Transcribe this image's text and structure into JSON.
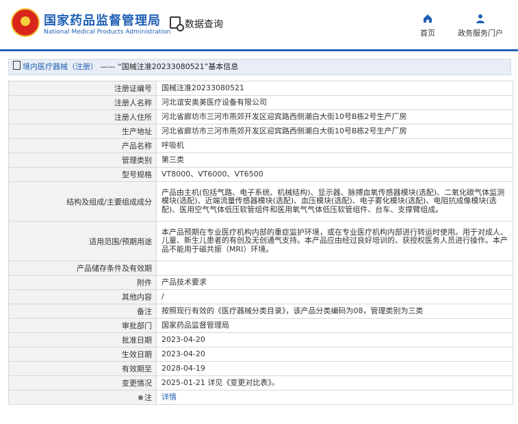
{
  "header": {
    "brand_cn": "国家药品监督管理局",
    "brand_en": "National Medical Products Administration",
    "data_query": "数据查询",
    "nav": [
      {
        "label": "首页",
        "icon": "home-icon"
      },
      {
        "label": "政务服务门户",
        "icon": "user-icon"
      }
    ]
  },
  "breadcrumb": {
    "category": "境内医疗器械（注册）",
    "separator": " —— ",
    "record": "“国械注准20233080521”基本信息"
  },
  "table": [
    {
      "key": "注册证编号",
      "value": "国械注准20233080521"
    },
    {
      "key": "注册人名称",
      "value": "河北谊安奥美医疗设备有限公司"
    },
    {
      "key": "注册人住所",
      "value": "河北省廊坊市三河市燕郊开发区迎宾路西侧潮白大街10号B栋2号生产厂房"
    },
    {
      "key": "生产地址",
      "value": "河北省廊坊市三河市燕郊开发区迎宾路西侧潮白大街10号B栋2号生产厂房"
    },
    {
      "key": "产品名称",
      "value": "呼吸机"
    },
    {
      "key": "管理类别",
      "value": "第三类"
    },
    {
      "key": "型号规格",
      "value": "VT8000、VT6000、VT6500"
    },
    {
      "key": "结构及组成/主要组成成分",
      "value": "产品由主机(包括气路、电子系统、机械结构)、显示器、脉搏血氧传感器模块(选配)、二氧化碳气体监测模块(选配)、近端流量传感器模块(选配)、血压模块(选配)、电子雾化模块(选配)、电阻抗成像模块(选配)、医用空气气体低压软管组件和医用氧气气体低压软管组件、台车、支撑臂组成。"
    },
    {
      "key": "适用范围/预期用途",
      "value": "本产品预期在专业医疗机构内部的重症监护环境，或在专业医疗机构内部进行转运时使用。用于对成人、儿童、新生儿患者的有创及无创通气支持。本产品应由经过良好培训的、获授权医务人员进行操作。本产品不能用于磁共振（MRI）环境。"
    },
    {
      "key": "产品储存条件及有效期",
      "value": ""
    },
    {
      "key": "附件",
      "value": "产品技术要求"
    },
    {
      "key": "其他内容",
      "value": "/"
    },
    {
      "key": "备注",
      "value": "按照现行有效的《医疗器械分类目录》，该产品分类编码为08，管理类别为三类"
    },
    {
      "key": "审批部门",
      "value": "国家药品监督管理局"
    },
    {
      "key": "批准日期",
      "value": "2023-04-20"
    },
    {
      "key": "生效日期",
      "value": "2023-04-20"
    },
    {
      "key": "有效期至",
      "value": "2028-04-19"
    },
    {
      "key": "变更情况",
      "value": "2025-01-21 详见《变更对比表》。"
    },
    {
      "key": "注",
      "value": "详情"
    }
  ]
}
